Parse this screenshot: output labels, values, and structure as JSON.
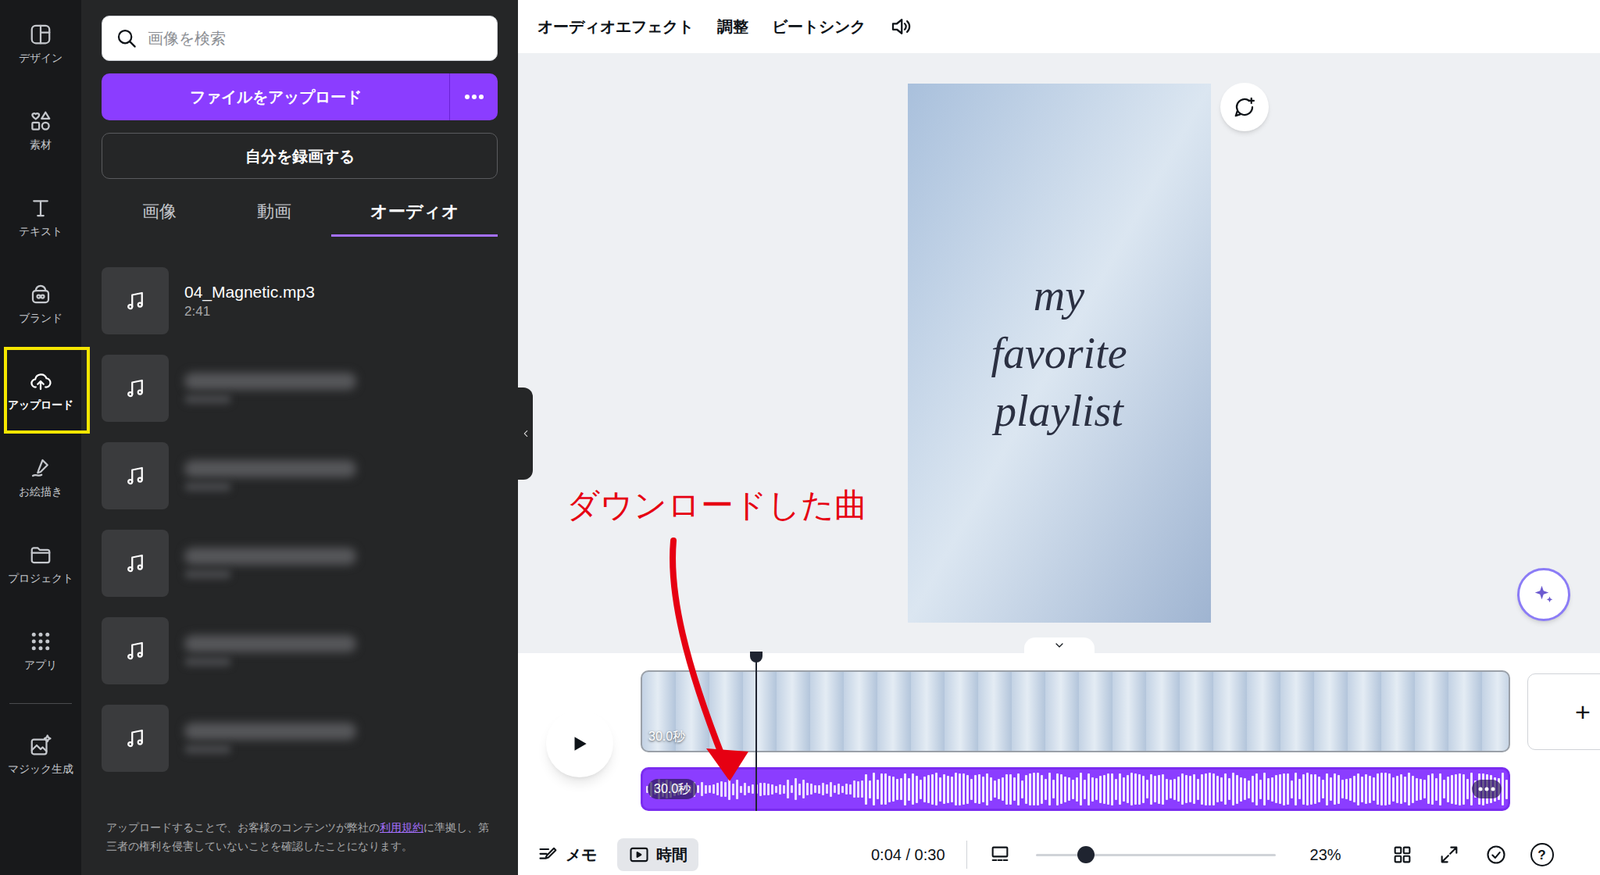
{
  "rail": {
    "main": [
      {
        "label": "デザイン",
        "selected": false,
        "highlighted": false
      },
      {
        "label": "素材",
        "selected": false,
        "highlighted": false
      },
      {
        "label": "テキスト",
        "selected": false,
        "highlighted": false
      },
      {
        "label": "ブランド",
        "selected": false,
        "highlighted": false
      },
      {
        "label": "アップロード",
        "selected": true,
        "highlighted": true
      },
      {
        "label": "お絵描き",
        "selected": false,
        "highlighted": false
      },
      {
        "label": "プロジェクト",
        "selected": false,
        "highlighted": false
      },
      {
        "label": "アプリ",
        "selected": false,
        "highlighted": false
      }
    ],
    "extra": [
      {
        "label": "マジック生成",
        "selected": false,
        "highlighted": false
      }
    ]
  },
  "panel": {
    "search": {
      "placeholder": "画像を検索"
    },
    "upload_button": "ファイルをアップロード",
    "record_button": "自分を録画する",
    "tabs": [
      {
        "label": "画像",
        "selected": false
      },
      {
        "label": "動画",
        "selected": false
      },
      {
        "label": "オーディオ",
        "selected": true
      }
    ],
    "audio_files": [
      {
        "name": "04_Magnetic.mp3",
        "duration": "2:41",
        "blurred": false
      },
      {
        "blurred": true
      },
      {
        "blurred": true
      },
      {
        "blurred": true
      },
      {
        "blurred": true
      },
      {
        "blurred": true
      }
    ],
    "footer": {
      "before": "アップロードすることで、お客様のコンテンツが弊社の",
      "link": "利用規約",
      "after": "に準拠し、第三者の権利を侵害していないことを確認したことになります。"
    }
  },
  "toolbar": [
    "オーディオエフェクト",
    "調整",
    "ビートシンク"
  ],
  "design": {
    "lines": [
      "my",
      "favorite",
      "playlist"
    ]
  },
  "annotation": {
    "label": "ダウンロードした曲",
    "color": "#e60012"
  },
  "timeline": {
    "video": {
      "duration": "30.0秒"
    },
    "audio": {
      "duration": "30.0秒",
      "selected": true
    },
    "add": "+",
    "playhead": {
      "level": 0.133
    }
  },
  "bottom_bar": {
    "notes": "メモ",
    "time_tab": {
      "label": "時間",
      "selected": true
    },
    "time": "0:04 / 0:30",
    "zoom": {
      "level": 0.21,
      "reading": "23%"
    },
    "help": "?"
  }
}
